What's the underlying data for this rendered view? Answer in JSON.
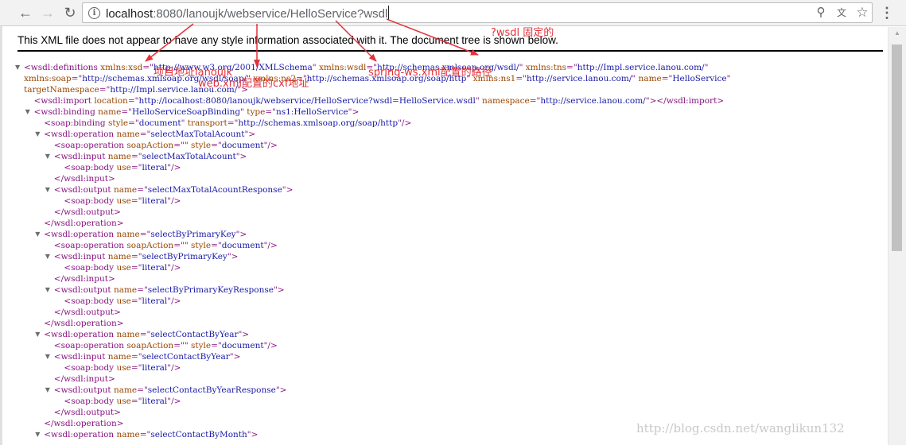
{
  "browser": {
    "url_host": "localhost",
    "url_path": ":8080/lanoujk/webservice/HelloService?wsdl",
    "icons": {
      "back": "back-arrow-icon",
      "forward": "forward-arrow-icon",
      "reload": "reload-icon",
      "info": "info-icon",
      "zoom": "zoom-icon",
      "translate": "translate-icon",
      "bookmark": "star-icon",
      "menu": "menu-dots-icon"
    }
  },
  "page": {
    "banner": "This XML file does not appear to have any style information associated with it. The document tree is shown below."
  },
  "xml_lines": [
    {
      "indent": 0,
      "toggle": true,
      "parts": [
        {
          "t": "<wsdl:definitions ",
          "c": "tag"
        },
        {
          "t": "xmlns:xsd",
          "c": "an"
        },
        {
          "t": "=\"",
          "c": "tag"
        },
        {
          "t": "http://www.w3.org/2001/XMLSchema",
          "c": "av"
        },
        {
          "t": "\" ",
          "c": "tag"
        },
        {
          "t": "xmlns:wsdl",
          "c": "an"
        },
        {
          "t": "=\"",
          "c": "tag"
        },
        {
          "t": "http://schemas.xmlsoap.org/wsdl/",
          "c": "av"
        },
        {
          "t": "\" ",
          "c": "tag"
        },
        {
          "t": "xmlns:tns",
          "c": "an"
        },
        {
          "t": "=\"",
          "c": "tag"
        },
        {
          "t": "http://Impl.service.lanou.com/",
          "c": "av"
        },
        {
          "t": "\"",
          "c": "tag"
        }
      ]
    },
    {
      "indent": 0,
      "cont": true,
      "parts": [
        {
          "t": "xmlns:soap",
          "c": "an"
        },
        {
          "t": "=\"",
          "c": "tag"
        },
        {
          "t": "http://schemas.xmlsoap.org/wsdl/soap/",
          "c": "av"
        },
        {
          "t": "\" ",
          "c": "tag"
        },
        {
          "t": "xmlns:ns2",
          "c": "an"
        },
        {
          "t": "=\"",
          "c": "tag"
        },
        {
          "t": "http://schemas.xmlsoap.org/soap/http",
          "c": "av"
        },
        {
          "t": "\" ",
          "c": "tag"
        },
        {
          "t": "xmlns:ns1",
          "c": "an"
        },
        {
          "t": "=\"",
          "c": "tag"
        },
        {
          "t": "http://service.lanou.com/",
          "c": "av"
        },
        {
          "t": "\" ",
          "c": "tag"
        },
        {
          "t": "name",
          "c": "an"
        },
        {
          "t": "=\"",
          "c": "tag"
        },
        {
          "t": "HelloService",
          "c": "av"
        },
        {
          "t": "\"",
          "c": "tag"
        }
      ]
    },
    {
      "indent": 0,
      "cont": true,
      "parts": [
        {
          "t": "targetNamespace",
          "c": "an"
        },
        {
          "t": "=\"",
          "c": "tag"
        },
        {
          "t": "http://Impl.service.lanou.com/",
          "c": "av"
        },
        {
          "t": "\">",
          "c": "tag"
        }
      ]
    },
    {
      "indent": 1,
      "parts": [
        {
          "t": "<wsdl:import ",
          "c": "tag"
        },
        {
          "t": "location",
          "c": "an"
        },
        {
          "t": "=\"",
          "c": "tag"
        },
        {
          "t": "http://localhost:8080/lanoujk/webservice/HelloService?wsdl=HelloService.wsdl",
          "c": "av"
        },
        {
          "t": "\" ",
          "c": "tag"
        },
        {
          "t": "namespace",
          "c": "an"
        },
        {
          "t": "=\"",
          "c": "tag"
        },
        {
          "t": "http://service.lanou.com/",
          "c": "av"
        },
        {
          "t": "\">",
          "c": "tag"
        },
        {
          "t": "</wsdl:import>",
          "c": "tag"
        }
      ]
    },
    {
      "indent": 1,
      "toggle": true,
      "parts": [
        {
          "t": "<wsdl:binding ",
          "c": "tag"
        },
        {
          "t": "name",
          "c": "an"
        },
        {
          "t": "=\"",
          "c": "tag"
        },
        {
          "t": "HelloServiceSoapBinding",
          "c": "av"
        },
        {
          "t": "\" ",
          "c": "tag"
        },
        {
          "t": "type",
          "c": "an"
        },
        {
          "t": "=\"",
          "c": "tag"
        },
        {
          "t": "ns1:HelloService",
          "c": "av"
        },
        {
          "t": "\">",
          "c": "tag"
        }
      ]
    },
    {
      "indent": 2,
      "parts": [
        {
          "t": "<soap:binding ",
          "c": "tag"
        },
        {
          "t": "style",
          "c": "an"
        },
        {
          "t": "=\"",
          "c": "tag"
        },
        {
          "t": "document",
          "c": "av"
        },
        {
          "t": "\" ",
          "c": "tag"
        },
        {
          "t": "transport",
          "c": "an"
        },
        {
          "t": "=\"",
          "c": "tag"
        },
        {
          "t": "http://schemas.xmlsoap.org/soap/http",
          "c": "av"
        },
        {
          "t": "\"/>",
          "c": "tag"
        }
      ]
    },
    {
      "indent": 2,
      "toggle": true,
      "parts": [
        {
          "t": "<wsdl:operation ",
          "c": "tag"
        },
        {
          "t": "name",
          "c": "an"
        },
        {
          "t": "=\"",
          "c": "tag"
        },
        {
          "t": "selectMaxTotalAcount",
          "c": "av"
        },
        {
          "t": "\">",
          "c": "tag"
        }
      ]
    },
    {
      "indent": 3,
      "parts": [
        {
          "t": "<soap:operation ",
          "c": "tag"
        },
        {
          "t": "soapAction",
          "c": "an"
        },
        {
          "t": "=\"\" ",
          "c": "tag"
        },
        {
          "t": "style",
          "c": "an"
        },
        {
          "t": "=\"",
          "c": "tag"
        },
        {
          "t": "document",
          "c": "av"
        },
        {
          "t": "\"/>",
          "c": "tag"
        }
      ]
    },
    {
      "indent": 3,
      "toggle": true,
      "parts": [
        {
          "t": "<wsdl:input ",
          "c": "tag"
        },
        {
          "t": "name",
          "c": "an"
        },
        {
          "t": "=\"",
          "c": "tag"
        },
        {
          "t": "selectMaxTotalAcount",
          "c": "av"
        },
        {
          "t": "\">",
          "c": "tag"
        }
      ]
    },
    {
      "indent": 4,
      "parts": [
        {
          "t": "<soap:body ",
          "c": "tag"
        },
        {
          "t": "use",
          "c": "an"
        },
        {
          "t": "=\"",
          "c": "tag"
        },
        {
          "t": "literal",
          "c": "av"
        },
        {
          "t": "\"/>",
          "c": "tag"
        }
      ]
    },
    {
      "indent": 3,
      "parts": [
        {
          "t": "</wsdl:input>",
          "c": "tag"
        }
      ]
    },
    {
      "indent": 3,
      "toggle": true,
      "parts": [
        {
          "t": "<wsdl:output ",
          "c": "tag"
        },
        {
          "t": "name",
          "c": "an"
        },
        {
          "t": "=\"",
          "c": "tag"
        },
        {
          "t": "selectMaxTotalAcountResponse",
          "c": "av"
        },
        {
          "t": "\">",
          "c": "tag"
        }
      ]
    },
    {
      "indent": 4,
      "parts": [
        {
          "t": "<soap:body ",
          "c": "tag"
        },
        {
          "t": "use",
          "c": "an"
        },
        {
          "t": "=\"",
          "c": "tag"
        },
        {
          "t": "literal",
          "c": "av"
        },
        {
          "t": "\"/>",
          "c": "tag"
        }
      ]
    },
    {
      "indent": 3,
      "parts": [
        {
          "t": "</wsdl:output>",
          "c": "tag"
        }
      ]
    },
    {
      "indent": 2,
      "parts": [
        {
          "t": "</wsdl:operation>",
          "c": "tag"
        }
      ]
    },
    {
      "indent": 2,
      "toggle": true,
      "parts": [
        {
          "t": "<wsdl:operation ",
          "c": "tag"
        },
        {
          "t": "name",
          "c": "an"
        },
        {
          "t": "=\"",
          "c": "tag"
        },
        {
          "t": "selectByPrimaryKey",
          "c": "av"
        },
        {
          "t": "\">",
          "c": "tag"
        }
      ]
    },
    {
      "indent": 3,
      "parts": [
        {
          "t": "<soap:operation ",
          "c": "tag"
        },
        {
          "t": "soapAction",
          "c": "an"
        },
        {
          "t": "=\"\" ",
          "c": "tag"
        },
        {
          "t": "style",
          "c": "an"
        },
        {
          "t": "=\"",
          "c": "tag"
        },
        {
          "t": "document",
          "c": "av"
        },
        {
          "t": "\"/>",
          "c": "tag"
        }
      ]
    },
    {
      "indent": 3,
      "toggle": true,
      "parts": [
        {
          "t": "<wsdl:input ",
          "c": "tag"
        },
        {
          "t": "name",
          "c": "an"
        },
        {
          "t": "=\"",
          "c": "tag"
        },
        {
          "t": "selectByPrimaryKey",
          "c": "av"
        },
        {
          "t": "\">",
          "c": "tag"
        }
      ]
    },
    {
      "indent": 4,
      "parts": [
        {
          "t": "<soap:body ",
          "c": "tag"
        },
        {
          "t": "use",
          "c": "an"
        },
        {
          "t": "=\"",
          "c": "tag"
        },
        {
          "t": "literal",
          "c": "av"
        },
        {
          "t": "\"/>",
          "c": "tag"
        }
      ]
    },
    {
      "indent": 3,
      "parts": [
        {
          "t": "</wsdl:input>",
          "c": "tag"
        }
      ]
    },
    {
      "indent": 3,
      "toggle": true,
      "parts": [
        {
          "t": "<wsdl:output ",
          "c": "tag"
        },
        {
          "t": "name",
          "c": "an"
        },
        {
          "t": "=\"",
          "c": "tag"
        },
        {
          "t": "selectByPrimaryKeyResponse",
          "c": "av"
        },
        {
          "t": "\">",
          "c": "tag"
        }
      ]
    },
    {
      "indent": 4,
      "parts": [
        {
          "t": "<soap:body ",
          "c": "tag"
        },
        {
          "t": "use",
          "c": "an"
        },
        {
          "t": "=\"",
          "c": "tag"
        },
        {
          "t": "literal",
          "c": "av"
        },
        {
          "t": "\"/>",
          "c": "tag"
        }
      ]
    },
    {
      "indent": 3,
      "parts": [
        {
          "t": "</wsdl:output>",
          "c": "tag"
        }
      ]
    },
    {
      "indent": 2,
      "parts": [
        {
          "t": "</wsdl:operation>",
          "c": "tag"
        }
      ]
    },
    {
      "indent": 2,
      "toggle": true,
      "parts": [
        {
          "t": "<wsdl:operation ",
          "c": "tag"
        },
        {
          "t": "name",
          "c": "an"
        },
        {
          "t": "=\"",
          "c": "tag"
        },
        {
          "t": "selectContactByYear",
          "c": "av"
        },
        {
          "t": "\">",
          "c": "tag"
        }
      ]
    },
    {
      "indent": 3,
      "parts": [
        {
          "t": "<soap:operation ",
          "c": "tag"
        },
        {
          "t": "soapAction",
          "c": "an"
        },
        {
          "t": "=\"\" ",
          "c": "tag"
        },
        {
          "t": "style",
          "c": "an"
        },
        {
          "t": "=\"",
          "c": "tag"
        },
        {
          "t": "document",
          "c": "av"
        },
        {
          "t": "\"/>",
          "c": "tag"
        }
      ]
    },
    {
      "indent": 3,
      "toggle": true,
      "parts": [
        {
          "t": "<wsdl:input ",
          "c": "tag"
        },
        {
          "t": "name",
          "c": "an"
        },
        {
          "t": "=\"",
          "c": "tag"
        },
        {
          "t": "selectContactByYear",
          "c": "av"
        },
        {
          "t": "\">",
          "c": "tag"
        }
      ]
    },
    {
      "indent": 4,
      "parts": [
        {
          "t": "<soap:body ",
          "c": "tag"
        },
        {
          "t": "use",
          "c": "an"
        },
        {
          "t": "=\"",
          "c": "tag"
        },
        {
          "t": "literal",
          "c": "av"
        },
        {
          "t": "\"/>",
          "c": "tag"
        }
      ]
    },
    {
      "indent": 3,
      "parts": [
        {
          "t": "</wsdl:input>",
          "c": "tag"
        }
      ]
    },
    {
      "indent": 3,
      "toggle": true,
      "parts": [
        {
          "t": "<wsdl:output ",
          "c": "tag"
        },
        {
          "t": "name",
          "c": "an"
        },
        {
          "t": "=\"",
          "c": "tag"
        },
        {
          "t": "selectContactByYearResponse",
          "c": "av"
        },
        {
          "t": "\">",
          "c": "tag"
        }
      ]
    },
    {
      "indent": 4,
      "parts": [
        {
          "t": "<soap:body ",
          "c": "tag"
        },
        {
          "t": "use",
          "c": "an"
        },
        {
          "t": "=\"",
          "c": "tag"
        },
        {
          "t": "literal",
          "c": "av"
        },
        {
          "t": "\"/>",
          "c": "tag"
        }
      ]
    },
    {
      "indent": 3,
      "parts": [
        {
          "t": "</wsdl:output>",
          "c": "tag"
        }
      ]
    },
    {
      "indent": 2,
      "parts": [
        {
          "t": "</wsdl:operation>",
          "c": "tag"
        }
      ]
    },
    {
      "indent": 2,
      "toggle": true,
      "parts": [
        {
          "t": "<wsdl:operation ",
          "c": "tag"
        },
        {
          "t": "name",
          "c": "an"
        },
        {
          "t": "=\"",
          "c": "tag"
        },
        {
          "t": "selectContactByMonth",
          "c": "av"
        },
        {
          "t": "\">",
          "c": "tag"
        }
      ]
    }
  ],
  "annotations": {
    "project": "项目地址lanoujk",
    "cxf_config": "web.xml配置的cxf地址",
    "spring_path": "spring-ws.xml配置的路径",
    "wsdl_fixed": "?wsdl 固定的"
  },
  "watermark": "http://blog.csdn.net/wanglikun132",
  "colors": {
    "annotation": "#e2323b",
    "tag": "#881280",
    "attr_name": "#994500",
    "attr_value": "#1a1aa6"
  }
}
